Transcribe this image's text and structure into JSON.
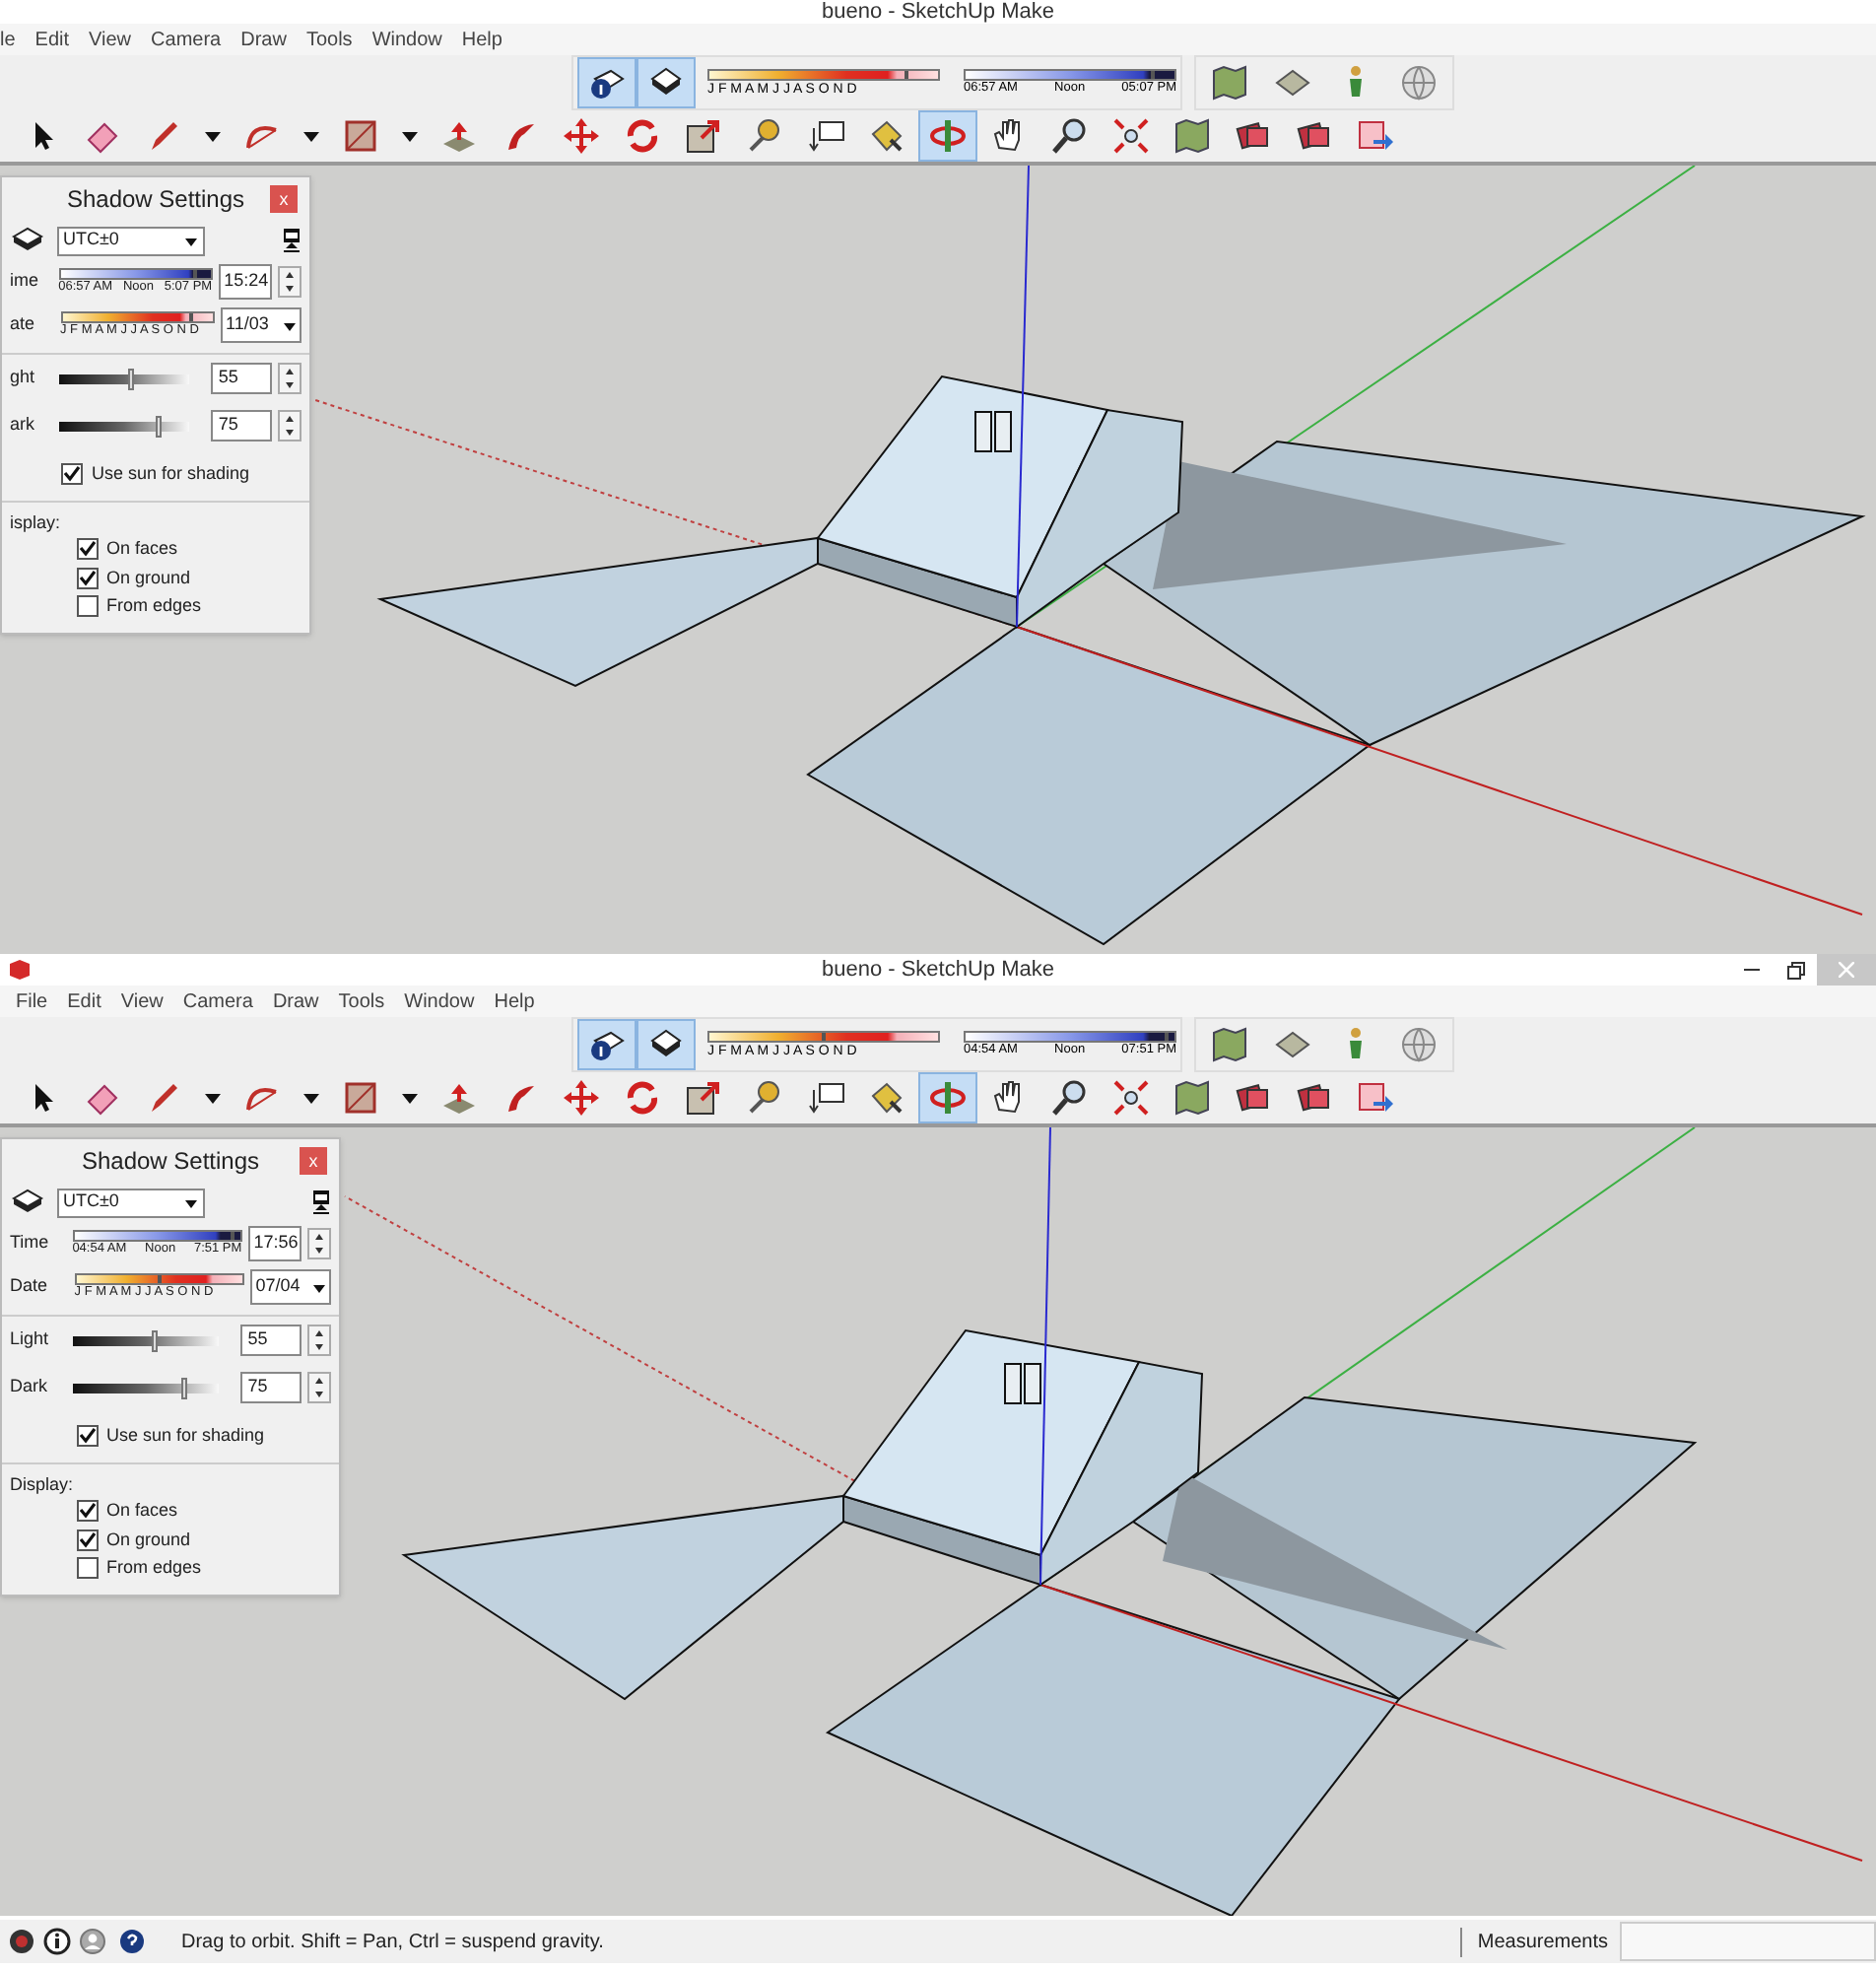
{
  "panes": [
    {
      "title": "bueno - SketchUp Make",
      "window_buttons": false,
      "menu": [
        "le",
        "Edit",
        "View",
        "Camera",
        "Draw",
        "Tools",
        "Window",
        "Help"
      ],
      "shadow_toggles": [
        {
          "kind": "info",
          "selected": true
        },
        {
          "kind": "shade",
          "selected": true
        }
      ],
      "month_slider": {
        "months": "J F M A M J J A S O N D",
        "level": 0.86
      },
      "time_slider": {
        "start": "06:57 AM",
        "noon": "Noon",
        "end": "05:07 PM",
        "level": 0.9
      },
      "extra_tools": [
        {
          "kind": "map",
          "selected": false
        },
        {
          "kind": "stack",
          "selected": false
        },
        {
          "kind": "figure",
          "selected": false
        },
        {
          "kind": "globe",
          "selected": false
        }
      ],
      "tools": [
        {
          "kind": "arrow",
          "selected": false
        },
        {
          "kind": "eraser",
          "selected": false
        },
        {
          "kind": "pencil",
          "selected": false
        },
        {
          "kind": "caret",
          "selected": false
        },
        {
          "kind": "arc",
          "selected": false
        },
        {
          "kind": "caret",
          "selected": false
        },
        {
          "kind": "rectangle",
          "selected": false
        },
        {
          "kind": "caret",
          "selected": false
        },
        {
          "kind": "pushpull",
          "selected": false
        },
        {
          "kind": "followme",
          "selected": false
        },
        {
          "kind": "move",
          "selected": false
        },
        {
          "kind": "rotate",
          "selected": false
        },
        {
          "kind": "scale",
          "selected": false
        },
        {
          "kind": "tape",
          "selected": false
        },
        {
          "kind": "text",
          "selected": false
        },
        {
          "kind": "paint",
          "selected": false
        },
        {
          "kind": "orbit",
          "selected": true
        },
        {
          "kind": "hand",
          "selected": false
        },
        {
          "kind": "magnifier",
          "selected": false
        },
        {
          "kind": "extents",
          "selected": false
        },
        {
          "kind": "map",
          "selected": false
        },
        {
          "kind": "cards",
          "selected": false
        },
        {
          "kind": "cards",
          "selected": false
        },
        {
          "kind": "share",
          "selected": false
        }
      ],
      "shadow_settings": {
        "title": "Shadow Settings",
        "close": "x",
        "timezone": "UTC±0",
        "time": {
          "label": "ime",
          "start": "06:57 AM",
          "noon": "Noon",
          "end": "5:07 PM",
          "level": 0.9,
          "value": "15:24"
        },
        "date": {
          "label": "ate",
          "months": "J F M A M J J A S O N D",
          "level": 0.86,
          "value": "11/03"
        },
        "light": {
          "label": "ght",
          "level": 0.55,
          "value": "55"
        },
        "dark": {
          "label": "ark",
          "level": 0.75,
          "value": "75"
        },
        "use_sun": {
          "label": "Use sun for shading",
          "checked": true
        },
        "display": {
          "label": "isplay:",
          "options": [
            {
              "label": "On faces",
              "checked": true
            },
            {
              "label": "On ground",
              "checked": true
            },
            {
              "label": "From edges",
              "checked": false
            }
          ]
        }
      }
    },
    {
      "title": "bueno - SketchUp Make",
      "window_buttons": true,
      "menu": [
        "File",
        "Edit",
        "View",
        "Camera",
        "Draw",
        "Tools",
        "Window",
        "Help"
      ],
      "shadow_toggles": [
        {
          "kind": "info",
          "selected": true
        },
        {
          "kind": "shade",
          "selected": true
        }
      ],
      "month_slider": {
        "months": "J F M A M J J A S O N D",
        "level": 0.5
      },
      "time_slider": {
        "start": "04:54 AM",
        "noon": "Noon",
        "end": "07:51 PM",
        "level": 0.96
      },
      "extra_tools": [
        {
          "kind": "map",
          "selected": false
        },
        {
          "kind": "stack",
          "selected": false
        },
        {
          "kind": "figure",
          "selected": false
        },
        {
          "kind": "globe",
          "selected": false
        }
      ],
      "tools": [
        {
          "kind": "arrow",
          "selected": false
        },
        {
          "kind": "eraser",
          "selected": false
        },
        {
          "kind": "pencil",
          "selected": false
        },
        {
          "kind": "caret",
          "selected": false
        },
        {
          "kind": "arc",
          "selected": false
        },
        {
          "kind": "caret",
          "selected": false
        },
        {
          "kind": "rectangle",
          "selected": false
        },
        {
          "kind": "caret",
          "selected": false
        },
        {
          "kind": "pushpull",
          "selected": false
        },
        {
          "kind": "followme",
          "selected": false
        },
        {
          "kind": "move",
          "selected": false
        },
        {
          "kind": "rotate",
          "selected": false
        },
        {
          "kind": "scale",
          "selected": false
        },
        {
          "kind": "tape",
          "selected": false
        },
        {
          "kind": "text",
          "selected": false
        },
        {
          "kind": "paint",
          "selected": false
        },
        {
          "kind": "orbit",
          "selected": true
        },
        {
          "kind": "hand",
          "selected": false
        },
        {
          "kind": "magnifier",
          "selected": false
        },
        {
          "kind": "extents",
          "selected": false
        },
        {
          "kind": "map",
          "selected": false
        },
        {
          "kind": "cards",
          "selected": false
        },
        {
          "kind": "cards",
          "selected": false
        },
        {
          "kind": "share",
          "selected": false
        }
      ],
      "shadow_settings": {
        "title": "Shadow Settings",
        "close": "x",
        "timezone": "UTC±0",
        "time": {
          "label": "Time",
          "start": "04:54 AM",
          "noon": "Noon",
          "end": "7:51 PM",
          "level": 0.96,
          "value": "17:56"
        },
        "date": {
          "label": "Date",
          "months": "J F M A M J J A S O N D",
          "level": 0.5,
          "value": "07/04"
        },
        "light": {
          "label": "Light",
          "level": 0.55,
          "value": "55"
        },
        "dark": {
          "label": "Dark",
          "level": 0.75,
          "value": "75"
        },
        "use_sun": {
          "label": "Use sun for shading",
          "checked": true
        },
        "display": {
          "label": "Display:",
          "options": [
            {
              "label": "On faces",
              "checked": true
            },
            {
              "label": "On ground",
              "checked": true
            },
            {
              "label": "From edges",
              "checked": false
            }
          ]
        }
      }
    }
  ],
  "status_bar": {
    "message": "Drag to orbit. Shift = Pan, Ctrl = suspend gravity.",
    "measurements_label": "Measurements"
  }
}
